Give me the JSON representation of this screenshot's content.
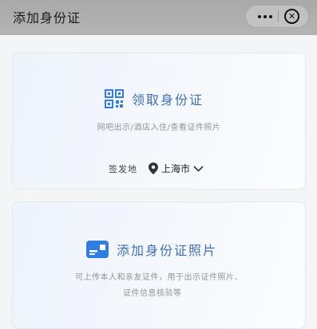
{
  "header": {
    "title": "添加身份证",
    "menu_icon": "more-dots-icon",
    "close_icon": "close-circle-icon"
  },
  "card_collect": {
    "icon": "qr-code-icon",
    "title": "领取身份证",
    "description": "网吧出示/酒店入住/查看证件照片",
    "location_label": "签发地",
    "location_icon": "location-pin-icon",
    "city": "上海市",
    "dropdown_icon": "chevron-down-icon"
  },
  "card_photo": {
    "icon": "id-card-icon",
    "title": "添加身份证照片",
    "description_line1": "可上传本人和亲友证件，用于出示证件照片、",
    "description_line2": "证件信息核验等"
  },
  "colors": {
    "accent": "#3d6fb3",
    "icon_blue": "#2f7de1"
  }
}
